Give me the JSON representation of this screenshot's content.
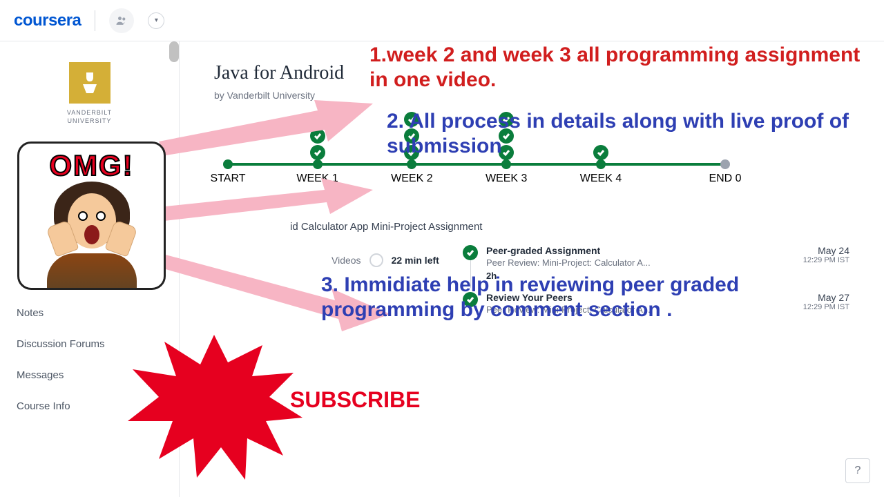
{
  "brand": "coursera",
  "university": {
    "name": "VANDERBILT\nUNIVERSITY"
  },
  "sidebar": {
    "items": [
      {
        "label": "Notes"
      },
      {
        "label": "Discussion Forums"
      },
      {
        "label": "Messages"
      },
      {
        "label": "Course Info"
      }
    ]
  },
  "course": {
    "title": "Java for Android",
    "byline": "by Vanderbilt University"
  },
  "timeline": {
    "labels": [
      "START",
      "WEEK 1",
      "WEEK 2",
      "WEEK 3",
      "WEEK 4",
      "END 0"
    ],
    "positions": [
      0,
      18,
      37,
      56,
      75,
      100
    ],
    "checks": [
      {
        "pos": 18,
        "count": 3
      },
      {
        "pos": 37,
        "count": 3
      },
      {
        "pos": 56,
        "count": 3
      },
      {
        "pos": 75,
        "count": 1
      }
    ]
  },
  "assignment": {
    "title": "id Calculator App Mini-Project Assignment",
    "videos_label": "Videos",
    "videos_time": "22 min left"
  },
  "tasks": [
    {
      "title": "Peer-graded Assignment",
      "sub": "Peer Review: Mini-Project: Calculator A...",
      "duration": "2h",
      "date": "May 24",
      "time": "12:29 PM IST"
    },
    {
      "title": "Review Your Peers",
      "sub": "Peer Review: Mini-Project: Calculator A...",
      "duration": "",
      "date": "May 27",
      "time": "12:29 PM IST"
    }
  ],
  "overlay": {
    "line1_prefix": "1.",
    "line1": "week 2 and week 3 all programming assignment in one video.",
    "line2_prefix": "2.",
    "line2": " All process in details along with live proof of submission",
    "line3_prefix": "3.",
    "line3": " Immidiate help in reviewing peer graded programming by comment section .",
    "omg": "OMG!",
    "subscribe": "SUBSCRIBE"
  },
  "help": "?"
}
